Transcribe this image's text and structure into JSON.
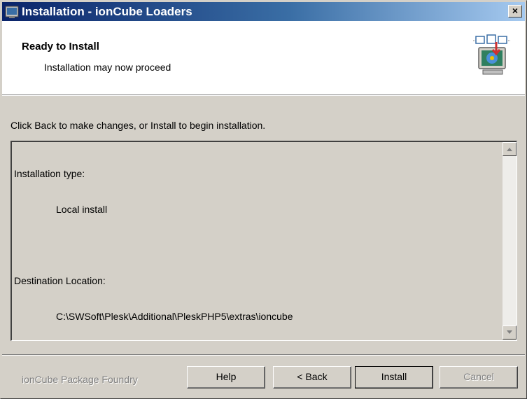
{
  "window": {
    "title": "Installation - ionCube Loaders",
    "close_label": "×"
  },
  "header": {
    "title": "Ready to Install",
    "subtitle": "Installation may now proceed",
    "icon": "installer-computer-icon"
  },
  "main": {
    "instruction": "Click Back to make changes, or Install to begin installation.",
    "summary": {
      "type_label": "Installation type:",
      "type_value": "Local install",
      "destination_label": "Destination Location:",
      "destination_value": "C:\\SWSoft\\Plesk\\Additional\\PleskPHP5\\extras\\ioncube"
    }
  },
  "footer": {
    "brand": "ionCube Package Foundry",
    "buttons": {
      "help": "Help",
      "back": "< Back",
      "install": "Install",
      "cancel": "Cancel"
    }
  },
  "colors": {
    "title_start": "#0a246a",
    "title_end": "#a6caf0",
    "face": "#d4d0c8",
    "disabled_text": "#808080"
  }
}
